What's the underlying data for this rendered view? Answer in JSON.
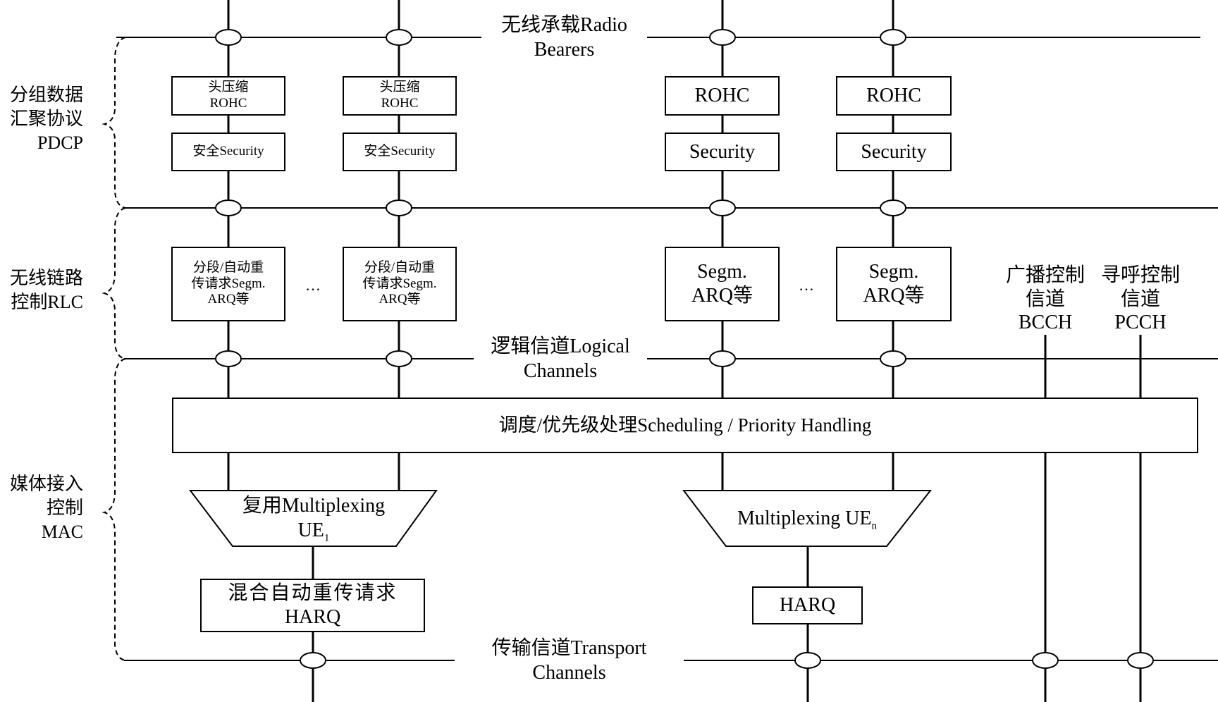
{
  "layers": {
    "pdcp": {
      "line1": "分组数据",
      "line2": "汇聚协议",
      "line3": "PDCP"
    },
    "rlc": {
      "line1": "无线链路",
      "line2": "控制RLC"
    },
    "mac": {
      "line1": "媒体接入",
      "line2": "控制",
      "line3": "MAC"
    }
  },
  "interfaces": {
    "radio_bearers": {
      "line1": "无线承载Radio",
      "line2": "Bearers"
    },
    "logical_channels": {
      "line1": "逻辑信道Logical",
      "line2": "Channels"
    },
    "transport_channels": {
      "line1": "传输信道Transport",
      "line2": "Channels"
    }
  },
  "pdcp_blocks": [
    {
      "rohc_cn": "头压缩",
      "rohc": "ROHC",
      "security": "安全Security"
    },
    {
      "rohc_cn": "头压缩",
      "rohc": "ROHC",
      "security": "安全Security"
    },
    {
      "rohc_cn": "",
      "rohc": "ROHC",
      "security": "Security"
    },
    {
      "rohc_cn": "",
      "rohc": "ROHC",
      "security": "Security"
    }
  ],
  "rlc_blocks": [
    {
      "line1": "分段/自动重",
      "line2": "传请求Segm.",
      "line3": "ARQ等"
    },
    {
      "line1": "分段/自动重",
      "line2": "传请求Segm.",
      "line3": "ARQ等"
    },
    {
      "line1": "Segm.",
      "line2": "ARQ等"
    },
    {
      "line1": "Segm.",
      "line2": "ARQ等"
    }
  ],
  "ellipsis": "…",
  "broadcast": {
    "line1": "广播控制",
    "line2": "信道",
    "line3": "BCCH"
  },
  "paging": {
    "line1": "寻呼控制",
    "line2": "信道",
    "line3": "PCCH"
  },
  "scheduling": "调度/优先级处理Scheduling / Priority Handling",
  "mux1": {
    "line1": "复用Multiplexing",
    "line2": "UE",
    "sub": "1"
  },
  "muxn": {
    "line1": "Multiplexing UE",
    "sub": "n"
  },
  "harq1": {
    "line1": "混合自动重传请求",
    "line2": "HARQ"
  },
  "harqn": {
    "line1": "HARQ"
  }
}
